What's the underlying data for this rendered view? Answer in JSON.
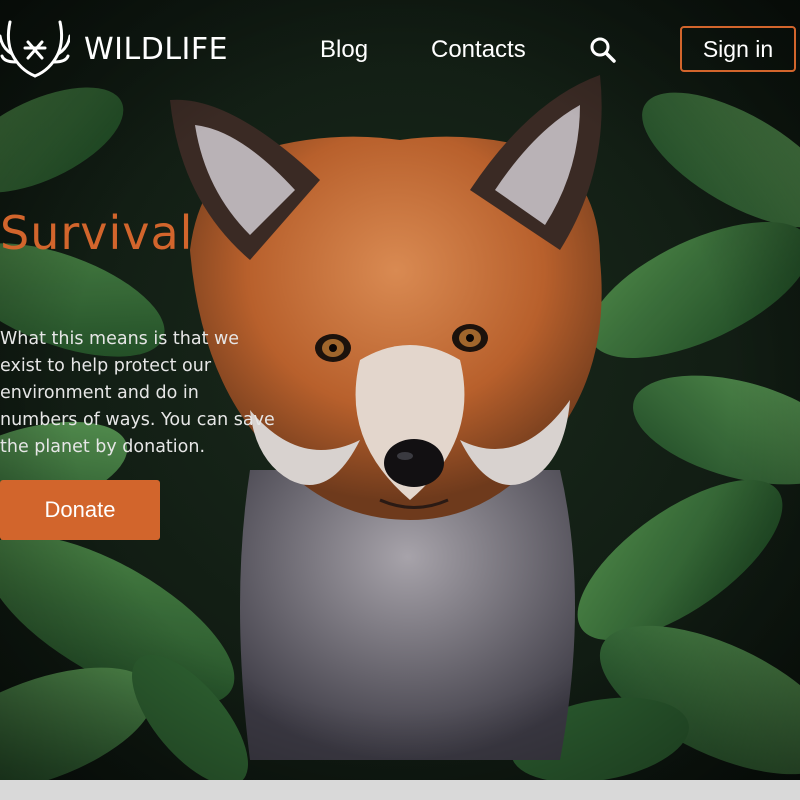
{
  "brand": {
    "name": "WILDLIFE",
    "logo_icon": "antlers-icon",
    "accent_color": "#d2652c"
  },
  "nav": {
    "items": [
      {
        "label": "Blog"
      },
      {
        "label": "Contacts"
      }
    ],
    "search_icon": "search-icon",
    "sign_in_label": "Sign in"
  },
  "hero": {
    "title": "Survival",
    "description": "What this means is that we exist to help protect our environment and do in numbers of ways. You can save the planet by donation.",
    "donate_label": "Donate",
    "background_image": "fox-in-foliage-photo"
  }
}
